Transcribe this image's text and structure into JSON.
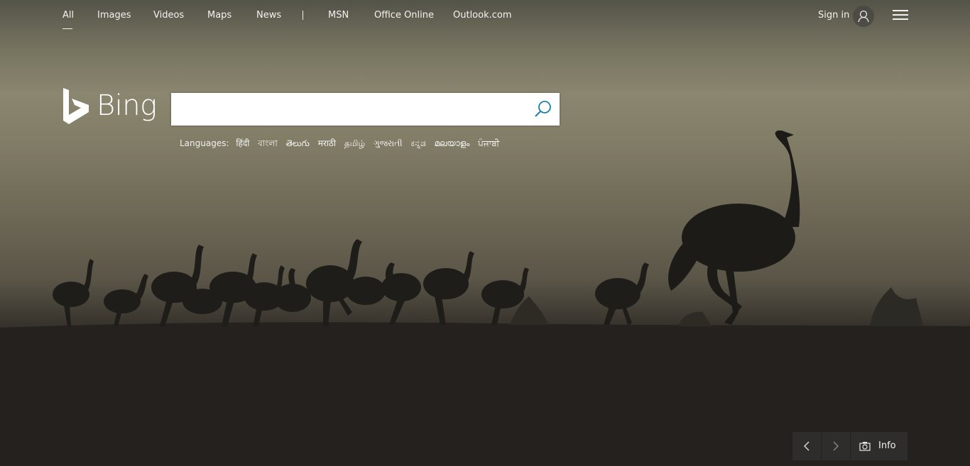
{
  "nav": {
    "items": [
      {
        "label": "All",
        "active": true
      },
      {
        "label": "Images"
      },
      {
        "label": "Videos"
      },
      {
        "label": "Maps"
      },
      {
        "label": "News"
      },
      {
        "label": "MSN"
      },
      {
        "label": "Office Online"
      },
      {
        "label": "Outlook.com"
      }
    ],
    "separator": "|"
  },
  "account": {
    "signin_label": "Sign in",
    "avatar_icon": "user-icon",
    "menu_icon": "hamburger-menu-icon"
  },
  "logo": {
    "text": "Bing",
    "icon": "bing-b-logo-icon"
  },
  "search": {
    "value": "",
    "placeholder": "",
    "button_icon": "search-icon",
    "accent": "#1f7ea8"
  },
  "languages": {
    "label": "Languages:",
    "items": [
      "हिंदी",
      "বাংলা",
      "తెలుగు",
      "मराठी",
      "தமிழ்",
      "ગુજરાતી",
      "ಕನ್ನಡ",
      "മലയാളം",
      "ਪੰਜਾਬੀ"
    ]
  },
  "controls": {
    "prev_icon": "chevron-left-icon",
    "next_icon": "chevron-right-icon",
    "info_icon": "camera-icon",
    "info_label": "Info"
  },
  "background": {
    "sky_color": "#8a8670",
    "ground_color": "#242220"
  }
}
